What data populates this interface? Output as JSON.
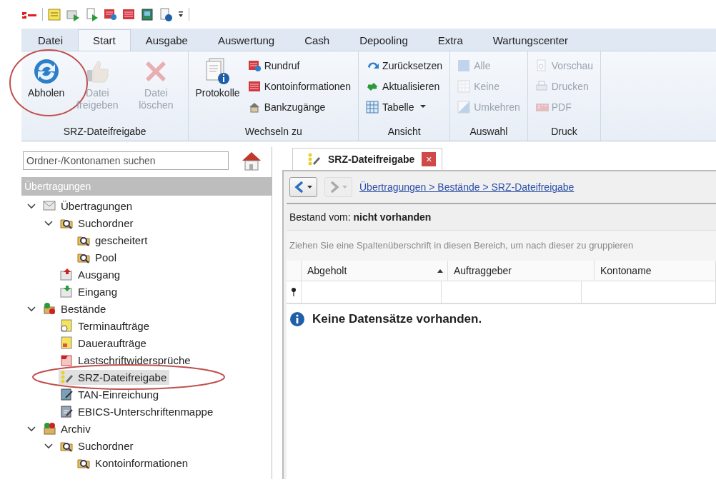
{
  "ribbon_tabs": [
    {
      "label": "Datei",
      "selected": false
    },
    {
      "label": "Start",
      "selected": true
    },
    {
      "label": "Ausgabe",
      "selected": false
    },
    {
      "label": "Auswertung",
      "selected": false
    },
    {
      "label": "Cash",
      "selected": false
    },
    {
      "label": "Depooling",
      "selected": false
    },
    {
      "label": "Extra",
      "selected": false
    },
    {
      "label": "Wartungscenter",
      "selected": false
    }
  ],
  "ribbon_groups": [
    {
      "title": "SRZ-Dateifreigabe",
      "items": [
        {
          "kind": "large",
          "label": "Abholen",
          "disabled": false,
          "annotated": true
        },
        {
          "kind": "large",
          "label": "Datei freigeben",
          "disabled": true
        },
        {
          "kind": "large",
          "label": "Datei löschen",
          "disabled": true
        }
      ]
    },
    {
      "title": "Wechseln zu",
      "items": [
        {
          "kind": "large",
          "label": "Protokolle",
          "disabled": false
        },
        {
          "kind": "small",
          "label": "Rundruf",
          "disabled": false
        },
        {
          "kind": "small",
          "label": "Kontoinformationen",
          "disabled": false
        },
        {
          "kind": "small",
          "label": "Bankzugänge",
          "disabled": false
        }
      ]
    },
    {
      "title": "Ansicht",
      "items": [
        {
          "kind": "small",
          "label": "Zurücksetzen",
          "disabled": false
        },
        {
          "kind": "small",
          "label": "Aktualisieren",
          "disabled": false
        },
        {
          "kind": "dropdown",
          "label": "Tabelle",
          "disabled": false
        }
      ]
    },
    {
      "title": "Auswahl",
      "items": [
        {
          "kind": "small",
          "label": "Alle",
          "disabled": true
        },
        {
          "kind": "small",
          "label": "Keine",
          "disabled": true
        },
        {
          "kind": "small",
          "label": "Umkehren",
          "disabled": true
        }
      ]
    },
    {
      "title": "Druck",
      "items": [
        {
          "kind": "small",
          "label": "Vorschau",
          "disabled": true
        },
        {
          "kind": "small",
          "label": "Drucken",
          "disabled": true
        },
        {
          "kind": "small",
          "label": "PDF",
          "disabled": true
        }
      ]
    }
  ],
  "sidebar": {
    "search": {
      "placeholder": "Ordner-/Kontonamen suchen"
    },
    "header": "Übertragungen",
    "tree": [
      {
        "label": "Übertragungen",
        "expanded": true,
        "selected": false,
        "children": [
          {
            "label": "Suchordner",
            "expanded": true,
            "selected": false,
            "children": [
              {
                "label": "gescheitert",
                "selected": false
              },
              {
                "label": "Pool",
                "selected": false
              }
            ]
          },
          {
            "label": "Ausgang",
            "selected": false
          },
          {
            "label": "Eingang",
            "selected": false
          }
        ]
      },
      {
        "label": "Bestände",
        "expanded": true,
        "selected": false,
        "children": [
          {
            "label": "Terminaufträge",
            "selected": false
          },
          {
            "label": "Daueraufträge",
            "selected": false
          },
          {
            "label": "Lastschriftwidersprüche",
            "selected": false
          },
          {
            "label": "SRZ-Dateifreigabe",
            "selected": true,
            "annotated": true
          },
          {
            "label": "TAN-Einreichung",
            "selected": false
          },
          {
            "label": "EBICS-Unterschriftenmappe",
            "selected": false
          }
        ]
      },
      {
        "label": "Archiv",
        "expanded": true,
        "selected": false,
        "children": [
          {
            "label": "Suchordner",
            "expanded": true,
            "selected": false,
            "children": [
              {
                "label": "Kontoinformationen",
                "selected": false
              }
            ]
          }
        ]
      }
    ]
  },
  "document_tab": {
    "title": "SRZ-Dateifreigabe",
    "close": "×"
  },
  "navigation": {
    "back_disabled": false,
    "forward_disabled": true,
    "breadcrumb": "Übertragungen > Bestände > SRZ-Dateifreigabe"
  },
  "stock_line": {
    "label": "Bestand vom:",
    "value": "nicht vorhanden"
  },
  "group_hint": "Ziehen Sie eine Spaltenüberschrift in diesen Bereich, um nach dieser zu gruppieren",
  "table": {
    "columns": [
      {
        "label": "Abgeholt",
        "sort_ascending": true
      },
      {
        "label": "Auftraggeber",
        "sort_ascending": false
      },
      {
        "label": "Kontoname",
        "sort_ascending": false
      }
    ]
  },
  "empty_message": "Keine Datensätze vorhanden."
}
